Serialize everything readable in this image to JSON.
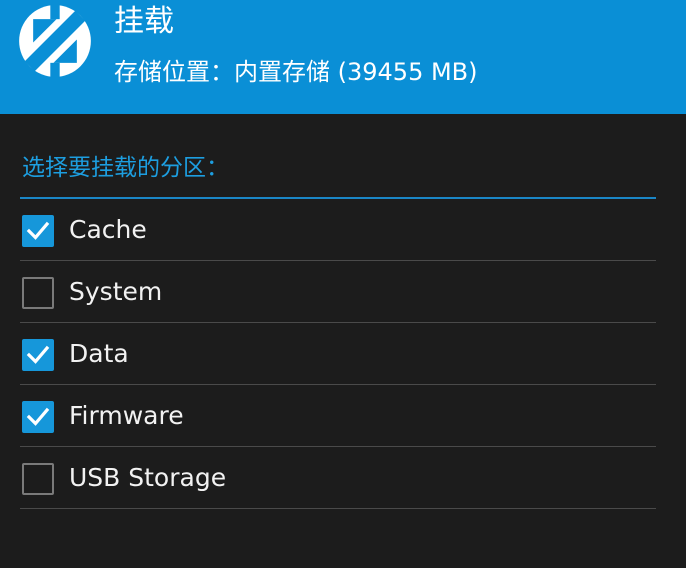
{
  "header": {
    "logo_icon": "twrp-logo-icon",
    "title": "挂载",
    "subtitle": "存储位置：内置存储 (39455 MB)",
    "background_color": "#0a8fd6"
  },
  "section": {
    "label": "选择要挂载的分区：",
    "accent_color": "#1d9ee0"
  },
  "partitions": [
    {
      "label": "Cache",
      "checked": true
    },
    {
      "label": "System",
      "checked": false
    },
    {
      "label": "Data",
      "checked": true
    },
    {
      "label": "Firmware",
      "checked": true
    },
    {
      "label": "USB Storage",
      "checked": false
    }
  ]
}
